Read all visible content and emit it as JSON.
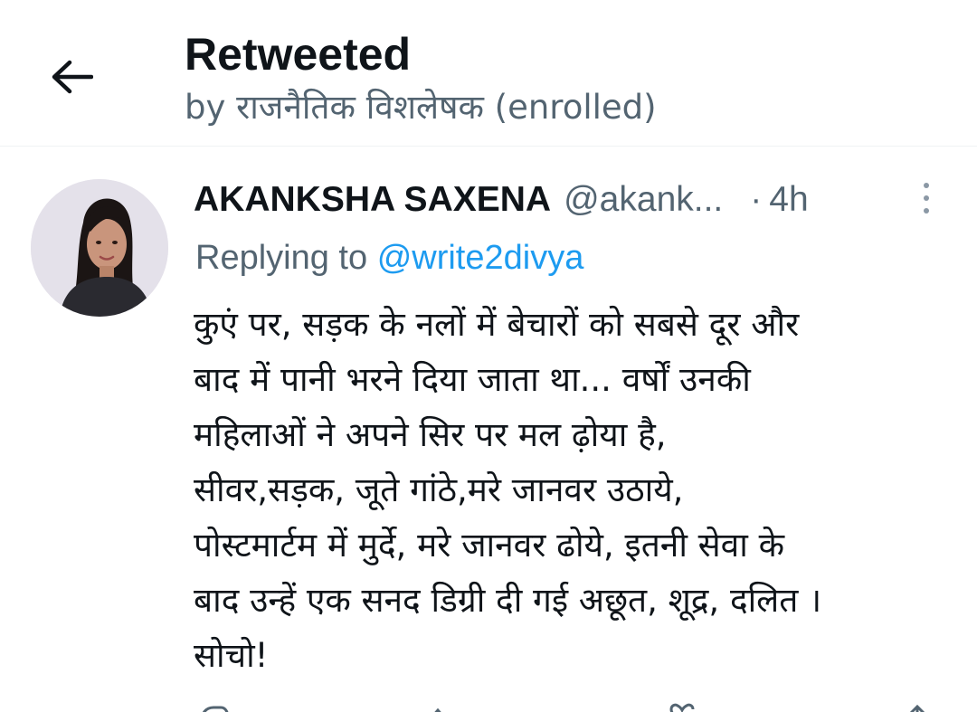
{
  "header": {
    "title": "Retweeted",
    "subtitle": "by राजनैतिक विशलेषक (enrolled)",
    "back_icon": "arrow-left-icon"
  },
  "tweet": {
    "author_name": "AKANKSHA SAXENA",
    "author_handle": "@akank...",
    "separator": "·",
    "timestamp": "4h",
    "replying_prefix": "Replying to",
    "replying_to": "@write2divya",
    "text_lines": [
      "कुएं पर, सड़क के नलों में बेचारों को सबसे दूर और",
      "बाद में पानी भरने दिया जाता था... वर्षों उनकी",
      "महिलाओं ने अपने सिर पर मल ढ़ोया है,",
      "सीवर,सड़क, जूते गांठे,मरे जानवर उठाये,",
      "पोस्टमार्टम में मुर्दे, मरे जानवर ढोये, इतनी सेवा के",
      "बाद उन्हें एक सनद डिग्री दी गई अछूत, शूद्र, दलित ।",
      "सोचो!"
    ],
    "more_icon": "more-vertical-icon",
    "action_icons": [
      "reply-icon",
      "retweet-icon",
      "like-icon",
      "share-icon"
    ]
  },
  "colors": {
    "text_primary": "#0f1419",
    "text_secondary": "#536471",
    "link": "#1d9bf0",
    "divider": "#eff3f4"
  }
}
